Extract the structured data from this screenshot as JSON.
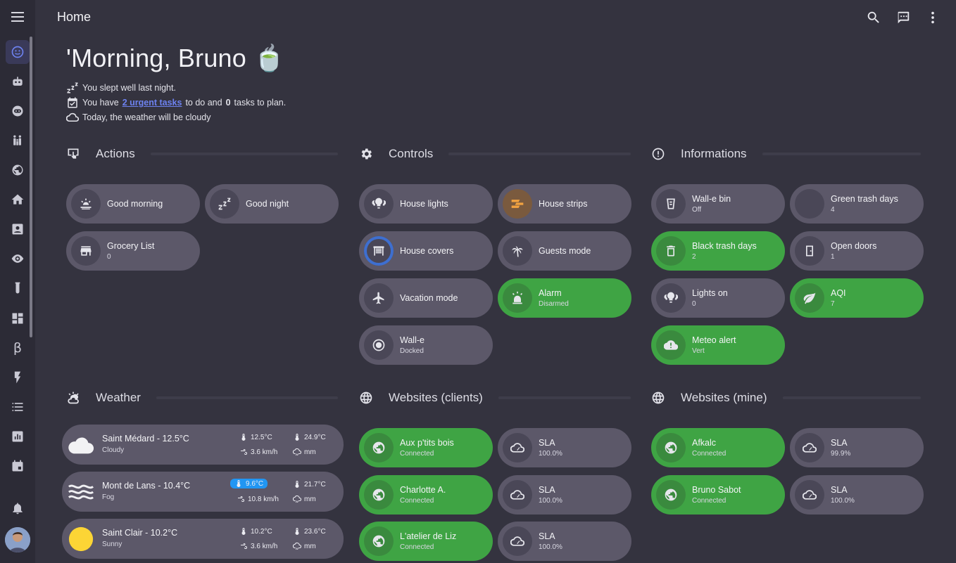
{
  "topbar": {
    "title": "Home"
  },
  "greeting": {
    "title": "'Morning, Bruno 🍵",
    "sleep": "You slept well last night.",
    "tasks_prefix": "You have",
    "tasks_link": "2 urgent tasks",
    "tasks_mid": "to do and",
    "tasks_count": "0",
    "tasks_suffix": "tasks to plan.",
    "weather": "Today, the weather will be cloudy"
  },
  "sections": {
    "actions": "Actions",
    "controls": "Controls",
    "informations": "Informations",
    "weather": "Weather",
    "websites_clients": "Websites (clients)",
    "websites_mine": "Websites (mine)"
  },
  "actions": [
    {
      "name": "Good morning",
      "sub": ""
    },
    {
      "name": "Good night",
      "sub": ""
    },
    {
      "name": "Grocery List",
      "sub": "0"
    }
  ],
  "controls": [
    {
      "name": "House lights",
      "sub": ""
    },
    {
      "name": "House strips",
      "sub": ""
    },
    {
      "name": "House covers",
      "sub": ""
    },
    {
      "name": "Guests mode",
      "sub": ""
    },
    {
      "name": "Vacation mode",
      "sub": ""
    },
    {
      "name": "Alarm",
      "sub": "Disarmed"
    },
    {
      "name": "Wall-e",
      "sub": "Docked"
    }
  ],
  "informations": [
    {
      "name": "Wall-e bin",
      "sub": "Off"
    },
    {
      "name": "Green trash days",
      "sub": "4"
    },
    {
      "name": "Black trash days",
      "sub": "2"
    },
    {
      "name": "Open doors",
      "sub": "1"
    },
    {
      "name": "Lights on",
      "sub": "0"
    },
    {
      "name": "AQI",
      "sub": "7"
    },
    {
      "name": "Meteo alert",
      "sub": "Vert"
    }
  ],
  "weather": [
    {
      "city": "Saint Médard  - 12.5°C",
      "cond": "Cloudy",
      "t_min": "12.5°C",
      "t_max": "24.9°C",
      "wind": "3.6 km/h",
      "rain": "mm"
    },
    {
      "city": "Mont de Lans  - 10.4°C",
      "cond": "Fog",
      "t_min": "9.6°C",
      "t_max": "21.7°C",
      "wind": "10.8 km/h",
      "rain": "mm"
    },
    {
      "city": "Saint Clair  - 10.2°C",
      "cond": "Sunny",
      "t_min": "10.2°C",
      "t_max": "23.6°C",
      "wind": "3.6 km/h",
      "rain": "mm"
    }
  ],
  "websites_clients": [
    {
      "name": "Aux p'tits bois",
      "sub": "Connected"
    },
    {
      "name": "SLA",
      "sub": "100.0%"
    },
    {
      "name": "Charlotte A.",
      "sub": "Connected"
    },
    {
      "name": "SLA",
      "sub": "100.0%"
    },
    {
      "name": "L'atelier de Liz",
      "sub": "Connected"
    },
    {
      "name": "SLA",
      "sub": "100.0%"
    }
  ],
  "websites_mine": [
    {
      "name": "Afkalc",
      "sub": "Connected"
    },
    {
      "name": "SLA",
      "sub": "99.9%"
    },
    {
      "name": "Bruno Sabot",
      "sub": "Connected"
    },
    {
      "name": "SLA",
      "sub": "100.0%"
    }
  ],
  "sidebar": {
    "beta_glyph": "β"
  },
  "colors": {
    "green": "#3fa444",
    "chip": "#5c5869",
    "accent": "#6d82f0",
    "highlight": "#2196f3"
  }
}
